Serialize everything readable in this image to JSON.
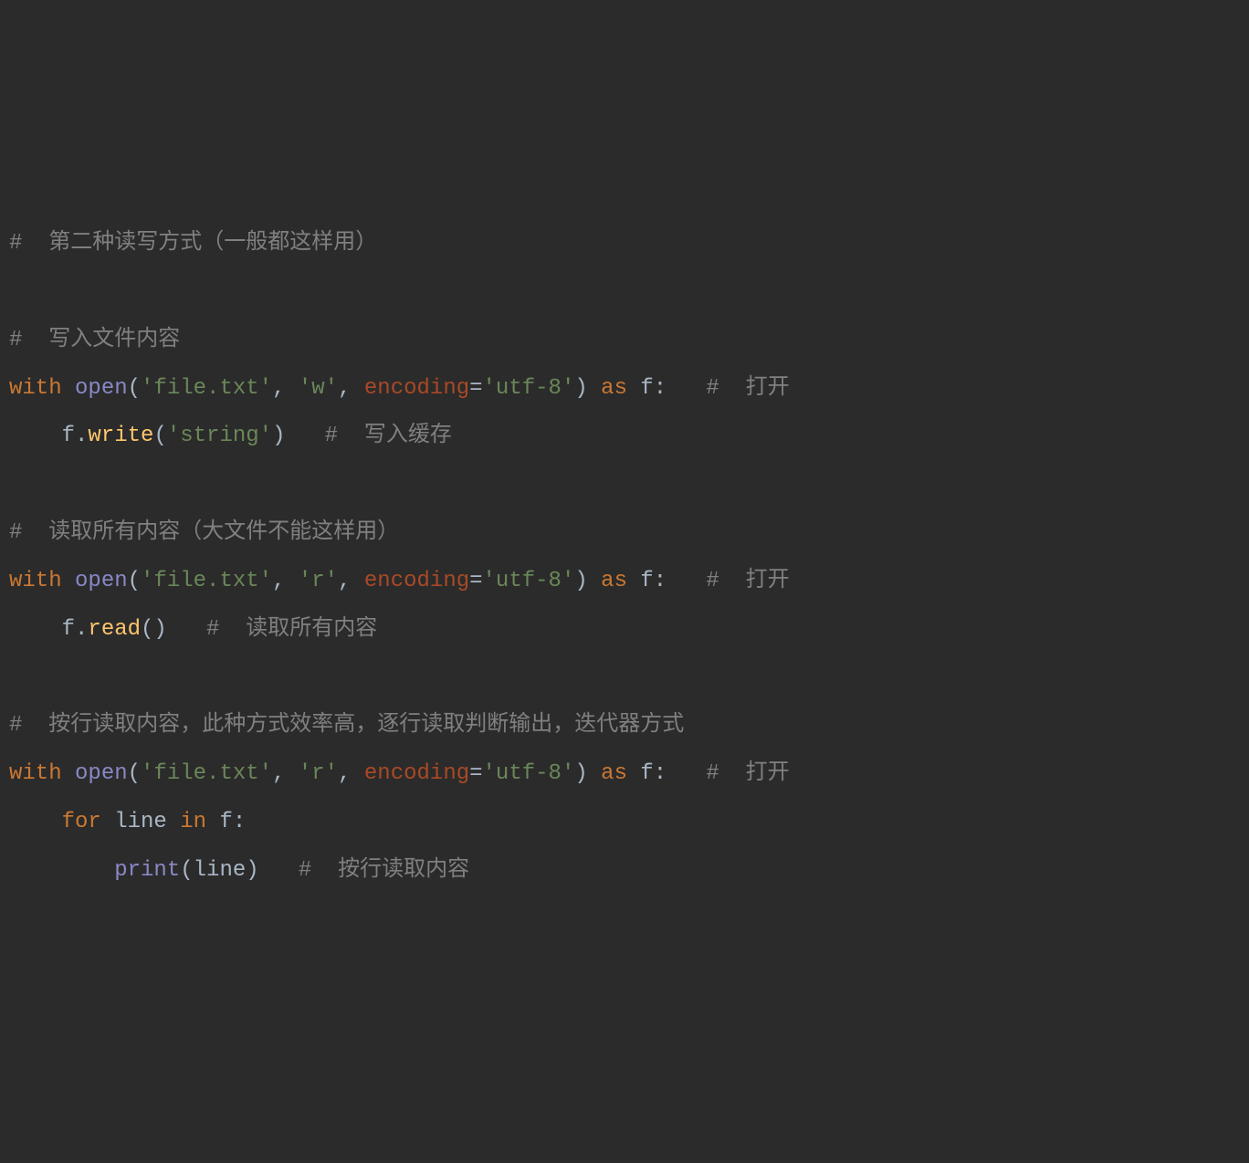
{
  "code": {
    "lines": [
      {
        "tokens": [
          {
            "cls": "comment",
            "text": "#  第二种读写方式（一般都这样用）"
          }
        ]
      },
      {
        "tokens": []
      },
      {
        "tokens": [
          {
            "cls": "comment",
            "text": "#  写入文件内容"
          }
        ]
      },
      {
        "tokens": [
          {
            "cls": "keyword",
            "text": "with "
          },
          {
            "cls": "builtin",
            "text": "open"
          },
          {
            "cls": "punct",
            "text": "("
          },
          {
            "cls": "string",
            "text": "'file.txt'"
          },
          {
            "cls": "punct",
            "text": ", "
          },
          {
            "cls": "string",
            "text": "'w'"
          },
          {
            "cls": "punct",
            "text": ", "
          },
          {
            "cls": "param",
            "text": "encoding"
          },
          {
            "cls": "punct",
            "text": "="
          },
          {
            "cls": "string",
            "text": "'utf-8'"
          },
          {
            "cls": "punct",
            "text": ") "
          },
          {
            "cls": "keyword",
            "text": "as "
          },
          {
            "cls": "ident",
            "text": "f"
          },
          {
            "cls": "punct",
            "text": ":   "
          },
          {
            "cls": "comment",
            "text": "#  打开"
          }
        ]
      },
      {
        "tokens": [
          {
            "cls": "ident",
            "text": "    f."
          },
          {
            "cls": "func",
            "text": "write"
          },
          {
            "cls": "punct",
            "text": "("
          },
          {
            "cls": "string",
            "text": "'string'"
          },
          {
            "cls": "punct",
            "text": ")   "
          },
          {
            "cls": "comment",
            "text": "#  写入缓存"
          }
        ]
      },
      {
        "tokens": []
      },
      {
        "tokens": [
          {
            "cls": "comment",
            "text": "#  读取所有内容（大文件不能这样用）"
          }
        ]
      },
      {
        "tokens": [
          {
            "cls": "keyword",
            "text": "with "
          },
          {
            "cls": "builtin",
            "text": "open"
          },
          {
            "cls": "punct",
            "text": "("
          },
          {
            "cls": "string",
            "text": "'file.txt'"
          },
          {
            "cls": "punct",
            "text": ", "
          },
          {
            "cls": "string",
            "text": "'r'"
          },
          {
            "cls": "punct",
            "text": ", "
          },
          {
            "cls": "param",
            "text": "encoding"
          },
          {
            "cls": "punct",
            "text": "="
          },
          {
            "cls": "string",
            "text": "'utf-8'"
          },
          {
            "cls": "punct",
            "text": ") "
          },
          {
            "cls": "keyword",
            "text": "as "
          },
          {
            "cls": "ident",
            "text": "f"
          },
          {
            "cls": "punct",
            "text": ":   "
          },
          {
            "cls": "comment",
            "text": "#  打开"
          }
        ]
      },
      {
        "tokens": [
          {
            "cls": "ident",
            "text": "    f."
          },
          {
            "cls": "func",
            "text": "read"
          },
          {
            "cls": "punct",
            "text": "()   "
          },
          {
            "cls": "comment",
            "text": "#  读取所有内容"
          }
        ]
      },
      {
        "tokens": []
      },
      {
        "tokens": [
          {
            "cls": "comment",
            "text": "#  按行读取内容，此种方式效率高，逐行读取判断输出，迭代器方式"
          }
        ]
      },
      {
        "tokens": [
          {
            "cls": "keyword",
            "text": "with "
          },
          {
            "cls": "builtin",
            "text": "open"
          },
          {
            "cls": "punct",
            "text": "("
          },
          {
            "cls": "string",
            "text": "'file.txt'"
          },
          {
            "cls": "punct",
            "text": ", "
          },
          {
            "cls": "string",
            "text": "'r'"
          },
          {
            "cls": "punct",
            "text": ", "
          },
          {
            "cls": "param",
            "text": "encoding"
          },
          {
            "cls": "punct",
            "text": "="
          },
          {
            "cls": "string",
            "text": "'utf-8'"
          },
          {
            "cls": "punct",
            "text": ") "
          },
          {
            "cls": "keyword",
            "text": "as "
          },
          {
            "cls": "ident",
            "text": "f"
          },
          {
            "cls": "punct",
            "text": ":   "
          },
          {
            "cls": "comment",
            "text": "#  打开"
          }
        ]
      },
      {
        "tokens": [
          {
            "cls": "ident",
            "text": "    "
          },
          {
            "cls": "keyword",
            "text": "for "
          },
          {
            "cls": "ident",
            "text": "line "
          },
          {
            "cls": "keyword",
            "text": "in "
          },
          {
            "cls": "ident",
            "text": "f"
          },
          {
            "cls": "punct",
            "text": ":"
          }
        ]
      },
      {
        "tokens": [
          {
            "cls": "ident",
            "text": "        "
          },
          {
            "cls": "builtin",
            "text": "print"
          },
          {
            "cls": "punct",
            "text": "(line)   "
          },
          {
            "cls": "comment",
            "text": "#  按行读取内容"
          }
        ]
      }
    ]
  }
}
